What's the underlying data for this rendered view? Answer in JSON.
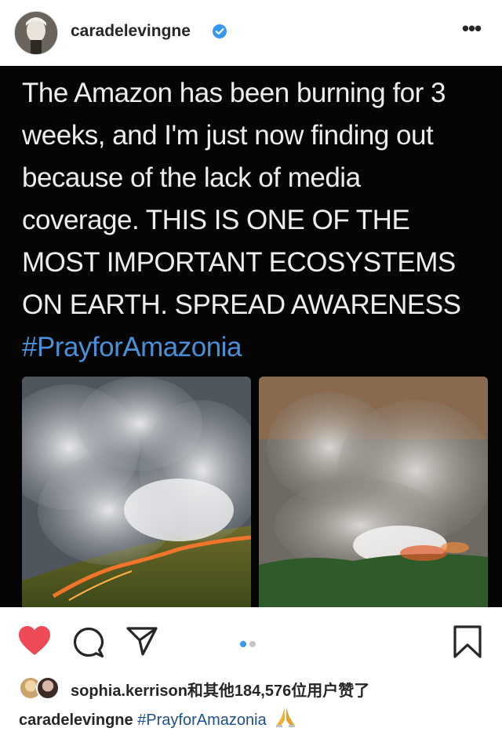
{
  "post_header": {
    "username": "caradelevingne",
    "verified_icon": "verified-badge-icon",
    "more_icon": "more-options-icon",
    "more_label": "•••",
    "verified_color": "#3897f0"
  },
  "post_image": {
    "lines": [
      "The Amazon has been burning for 3",
      "weeks, and I'm just now finding out",
      "because of the lack of media",
      "coverage. THIS IS ONE OF THE",
      "MOST IMPORTANT ECOSYSTEMS",
      "ON EARTH. SPREAD AWARENESS"
    ],
    "hashtag": "#PrayforAmazonia",
    "hashtag_color": "#4a90d9",
    "background_color": "#050505"
  },
  "actions": {
    "like_icon": "heart-filled-icon",
    "like_color": "#ed4956",
    "comment_icon": "comment-icon",
    "share_icon": "share-icon",
    "save_icon": "bookmark-icon",
    "carousel_index": 1,
    "carousel_count": 2
  },
  "likes": {
    "text": "sophia.kerrison和其他184,576位用户赞了"
  },
  "caption": {
    "username": "caradelevingne",
    "hashtag": "#PrayforAmazonia",
    "emoji_icon": "praying-hands-icon"
  }
}
